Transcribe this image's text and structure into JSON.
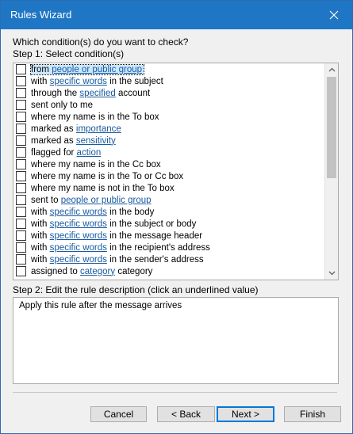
{
  "window": {
    "title": "Rules Wizard"
  },
  "prompt": "Which condition(s) do you want to check?",
  "step1_label": "Step 1: Select condition(s)",
  "conditions": [
    {
      "parts": [
        {
          "t": "from "
        },
        {
          "t": "people or public group",
          "u": true
        }
      ],
      "checked": false,
      "selected": true
    },
    {
      "parts": [
        {
          "t": "with "
        },
        {
          "t": "specific words",
          "u": true
        },
        {
          "t": " in the subject"
        }
      ],
      "checked": false
    },
    {
      "parts": [
        {
          "t": "through the "
        },
        {
          "t": "specified",
          "u": true
        },
        {
          "t": " account"
        }
      ],
      "checked": false
    },
    {
      "parts": [
        {
          "t": "sent only to me"
        }
      ],
      "checked": false
    },
    {
      "parts": [
        {
          "t": "where my name is in the To box"
        }
      ],
      "checked": false
    },
    {
      "parts": [
        {
          "t": "marked as "
        },
        {
          "t": "importance",
          "u": true
        }
      ],
      "checked": false
    },
    {
      "parts": [
        {
          "t": "marked as "
        },
        {
          "t": "sensitivity",
          "u": true
        }
      ],
      "checked": false
    },
    {
      "parts": [
        {
          "t": "flagged for "
        },
        {
          "t": "action",
          "u": true
        }
      ],
      "checked": false
    },
    {
      "parts": [
        {
          "t": "where my name is in the Cc box"
        }
      ],
      "checked": false
    },
    {
      "parts": [
        {
          "t": "where my name is in the To or Cc box"
        }
      ],
      "checked": false
    },
    {
      "parts": [
        {
          "t": "where my name is not in the To box"
        }
      ],
      "checked": false
    },
    {
      "parts": [
        {
          "t": "sent to "
        },
        {
          "t": "people or public group",
          "u": true
        }
      ],
      "checked": false
    },
    {
      "parts": [
        {
          "t": "with "
        },
        {
          "t": "specific words",
          "u": true
        },
        {
          "t": " in the body"
        }
      ],
      "checked": false
    },
    {
      "parts": [
        {
          "t": "with "
        },
        {
          "t": "specific words",
          "u": true
        },
        {
          "t": " in the subject or body"
        }
      ],
      "checked": false
    },
    {
      "parts": [
        {
          "t": "with "
        },
        {
          "t": "specific words",
          "u": true
        },
        {
          "t": " in the message header"
        }
      ],
      "checked": false
    },
    {
      "parts": [
        {
          "t": "with "
        },
        {
          "t": "specific words",
          "u": true
        },
        {
          "t": " in the recipient's address"
        }
      ],
      "checked": false
    },
    {
      "parts": [
        {
          "t": "with "
        },
        {
          "t": "specific words",
          "u": true
        },
        {
          "t": " in the sender's address"
        }
      ],
      "checked": false
    },
    {
      "parts": [
        {
          "t": "assigned to "
        },
        {
          "t": "category",
          "u": true
        },
        {
          "t": " category"
        }
      ],
      "checked": false
    }
  ],
  "step2_label": "Step 2: Edit the rule description (click an underlined value)",
  "description": "Apply this rule after the message arrives",
  "buttons": {
    "cancel": "Cancel",
    "back": "< Back",
    "next": "Next >",
    "finish": "Finish"
  },
  "colors": {
    "titlebar": "#1f76c4",
    "link": "#1a5aa0",
    "focus": "#0078d7"
  }
}
